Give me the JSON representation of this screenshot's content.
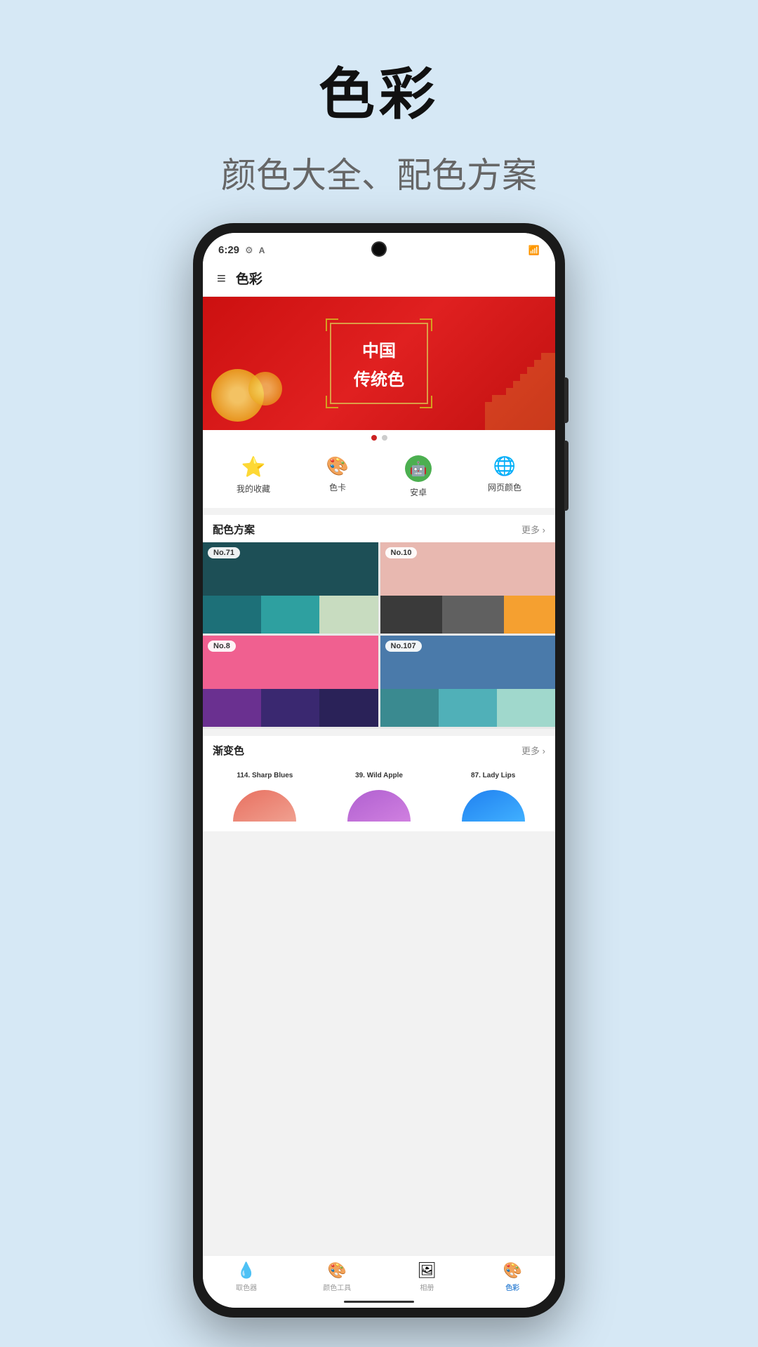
{
  "page": {
    "background": "#d6e8f5",
    "title": "色彩",
    "subtitle": "颜色大全、配色方案"
  },
  "statusBar": {
    "time": "6:29",
    "settingsIcon": "⚙",
    "signalIcon": "▶"
  },
  "appBar": {
    "menuIcon": "≡",
    "title": "色彩"
  },
  "banner": {
    "line1": "中国",
    "line2": "传统色",
    "dots": [
      "active",
      "inactive"
    ]
  },
  "quickNav": [
    {
      "icon": "⭐",
      "label": "我的收藏",
      "iconColor": "#f04060"
    },
    {
      "icon": "🎨",
      "label": "色卡",
      "iconColor": "#4472ca"
    },
    {
      "icon": "🤖",
      "label": "安卓",
      "iconColor": "#4caf50"
    },
    {
      "icon": "🌐",
      "label": "网页颜色",
      "iconColor": "#4472ca"
    }
  ],
  "palette": {
    "sectionTitle": "配色方案",
    "moreLabel": "更多",
    "cards": [
      {
        "badge": "No.71",
        "topColor": "#1d4f56",
        "swatches": [
          "#1d6e78",
          "#2ea0a0",
          "#c8dcc0"
        ]
      },
      {
        "badge": "No.10",
        "topColor": "#e8b8b0",
        "swatches": [
          "#3a3a3a",
          "#606060",
          "#f5a030"
        ]
      },
      {
        "badge": "No.8",
        "topColor": "#f06090",
        "swatches": [
          "#6a3090",
          "#3a2870",
          "#2a2258"
        ]
      },
      {
        "badge": "No.107",
        "topColor": "#4a7aaa",
        "swatches": [
          "#3a8a90",
          "#50b0b8",
          "#a0d8cc"
        ]
      }
    ]
  },
  "gradient": {
    "sectionTitle": "渐变色",
    "moreLabel": "更多",
    "items": [
      {
        "label": "114. Sharp Blues",
        "gradient": "linear-gradient(to bottom, #e87060, #f08878)",
        "gradientStart": "#e87060",
        "gradientEnd": "#f0a090"
      },
      {
        "label": "39. Wild Apple",
        "gradient": "linear-gradient(to bottom, #b060d0, #d080e0)",
        "gradientStart": "#b060d0",
        "gradientEnd": "#d080e0"
      },
      {
        "label": "87. Lady Lips",
        "gradient": "linear-gradient(to bottom, #2080f0, #40a0ff)",
        "gradientStart": "#2080f0",
        "gradientEnd": "#40b0ff"
      }
    ]
  },
  "bottomNav": [
    {
      "icon": "💧",
      "label": "取色器",
      "active": false
    },
    {
      "icon": "🎨",
      "label": "颜色工具",
      "active": false
    },
    {
      "icon": "🖼",
      "label": "相册",
      "active": false
    },
    {
      "icon": "🎨",
      "label": "色彩",
      "active": true
    }
  ]
}
